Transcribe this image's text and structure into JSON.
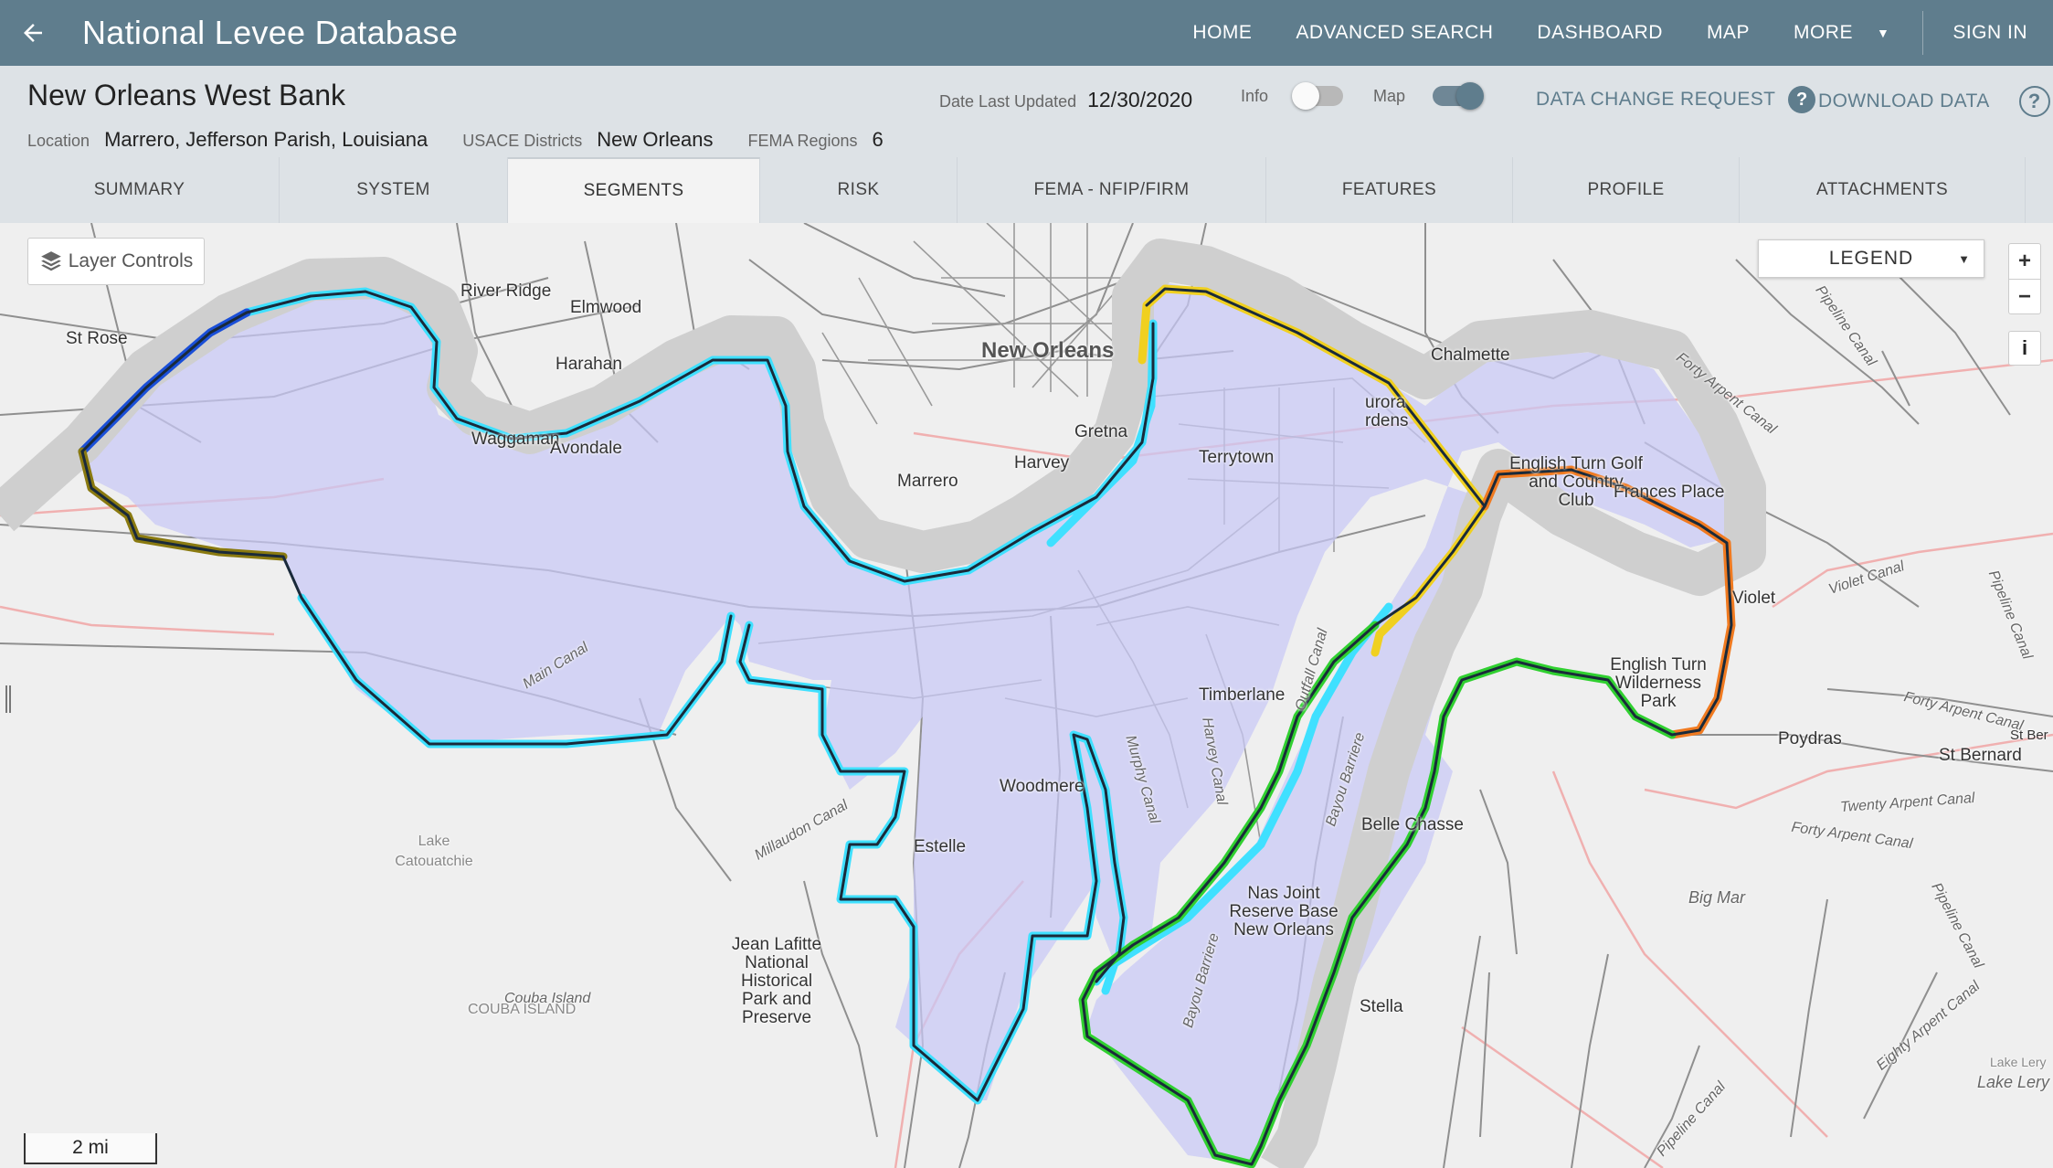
{
  "app": {
    "title": "National Levee Database"
  },
  "nav": {
    "home": "HOME",
    "advanced_search": "ADVANCED SEARCH",
    "dashboard": "DASHBOARD",
    "map": "MAP",
    "more": "MORE",
    "sign_in": "SIGN IN"
  },
  "system": {
    "name": "New Orleans West Bank",
    "date_label": "Date Last Updated",
    "date_value": "12/30/2020",
    "location_label": "Location",
    "location_value": "Marrero, Jefferson Parish, Louisiana",
    "districts_label": "USACE Districts",
    "districts_value": "New Orleans",
    "fema_label": "FEMA Regions",
    "fema_value": "6"
  },
  "toggles": {
    "info_label": "Info",
    "info_on": false,
    "map_label": "Map",
    "map_on": true
  },
  "actions": {
    "data_change_request": "DATA CHANGE REQUEST",
    "help": "?",
    "download_data": "DOWNLOAD DATA"
  },
  "tabs": [
    "SUMMARY",
    "SYSTEM",
    "SEGMENTS",
    "RISK",
    "FEMA - NFIP/FIRM",
    "FEATURES",
    "PROFILE",
    "ATTACHMENTS"
  ],
  "active_tab": "SEGMENTS",
  "map": {
    "layer_controls": "Layer Controls",
    "legend": "LEGEND",
    "zoom_in": "+",
    "zoom_out": "−",
    "info": "i",
    "scale": "2 mi",
    "colors": {
      "river": "#cfcfcf",
      "polygon_fill": "#c8c8f5",
      "cyan": "#3fe0ff",
      "blue": "#1a4fd8",
      "yellow": "#f0d020",
      "orange": "#f07a20",
      "green": "#30d030",
      "olive": "#8a7a10",
      "road": "#8a8a8a",
      "boundary": "#f0b0b0"
    },
    "labels": {
      "new_orleans": "New Orleans",
      "st_rose": "St Rose",
      "river_ridge": "River Ridge",
      "elmwood": "Elmwood",
      "harahan": "Harahan",
      "chalmette": "Chalmette",
      "waggaman": "Waggaman",
      "avondale": "Avondale",
      "harvey": "Harvey",
      "marrero": "Marrero",
      "gretna": "Gretna",
      "terrytown": "Terrytown",
      "aurora_gardens": "Aurora Gardens",
      "english_turn_golf": "English Turn Golf and Country Club",
      "english_turn_wilderness": "English Turn Wilderness Park",
      "frances_place": "Frances Place",
      "violet": "Violet",
      "poydras": "Poydras",
      "st_bernard": "St Bernard",
      "timberlane": "Timberlane",
      "woodmere": "Woodmere",
      "estelle": "Estelle",
      "belle_chasse": "Belle Chasse",
      "nas_jrb": "Nas Joint Reserve Base New Orleans",
      "stella": "Stella",
      "lake_cataouatche": "Lake Catouatchie",
      "jean_lafitte": "Jean Lafitte National Historical Park and Preserve",
      "couba_island": "Couba Island",
      "couba_island_gray": "COUBA ISLAND",
      "main_canal": "Main Canal",
      "millaudon_canal": "Millaudon Canal",
      "big_mar": "Big Mar",
      "violet_canal": "Violet Canal",
      "twenty_arpent": "Twenty Arpent Canal",
      "forty_arpent": "Forty Arpent Canal",
      "forty_arpent_2": "Forty Arpent Canal",
      "forty_arpent_3": "Forty Arpent Canal",
      "pipeline_canal": "Pipeline Canal",
      "pipeline_canal_2": "Pipeline Canal",
      "pipeline_canal_3": "Pipeline Canal",
      "pipeline_canal_4": "Pipeline Canal",
      "eighty_arpent": "Eighty Arpent Canal",
      "bayou_barriere": "Bayou Barriere",
      "bayou_barriere_2": "Bayou Barriere",
      "harvey_canal": "Harvey Canal",
      "murphy_canal": "Murphy Canal",
      "outfall_canal": "Outfall Canal",
      "lake_lery": "Lake Lery",
      "lake_lery_small": "Lake Lery",
      "st_ber_edge": "St Ber",
      "aurora_part": "urora",
      "gardens_part": "rdens"
    }
  }
}
